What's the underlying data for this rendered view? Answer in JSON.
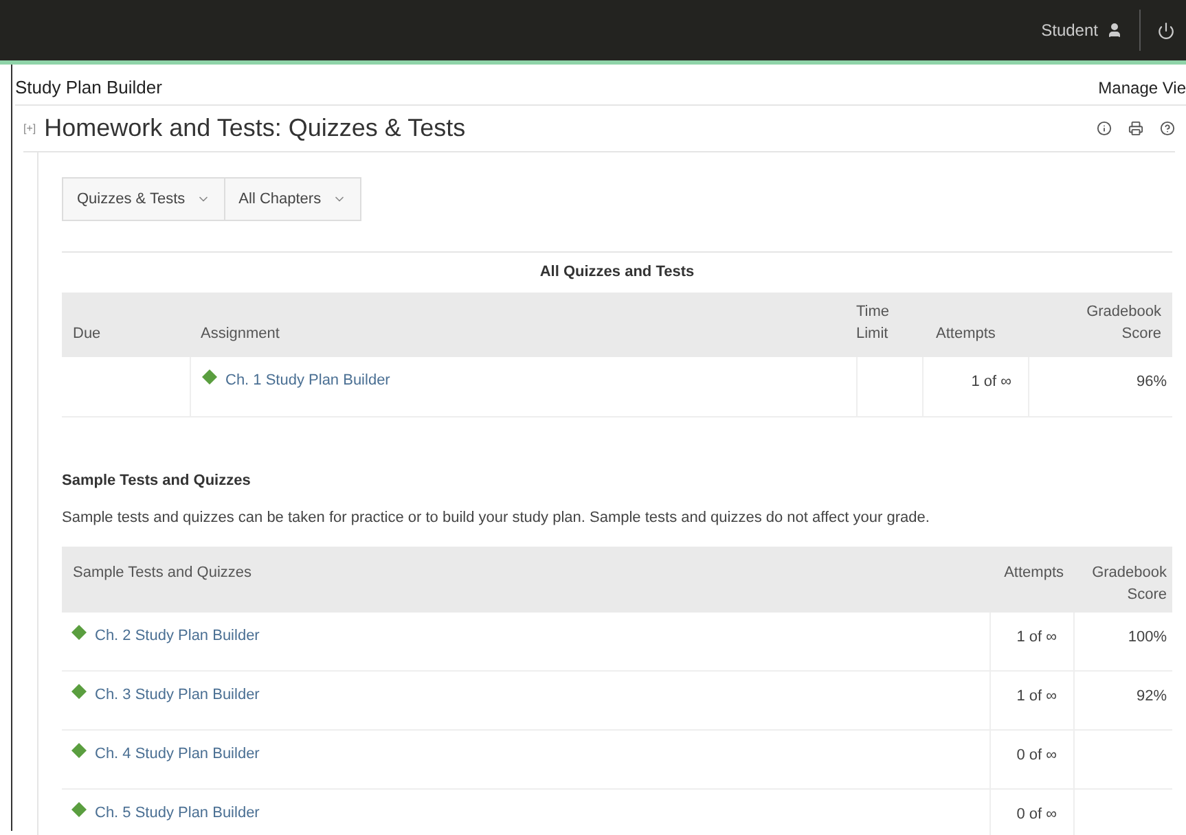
{
  "top_bar": {
    "user": "Student"
  },
  "page": {
    "title": "Study Plan Builder",
    "manage": "Manage Vie"
  },
  "panel": {
    "toggle": "[+]",
    "title": "Homework and Tests: Quizzes & Tests"
  },
  "filters": [
    "Quizzes & Tests",
    "All Chapters"
  ],
  "all_table": {
    "caption": "All Quizzes and Tests",
    "columns": [
      "Due",
      "Assignment",
      "Time Limit",
      "Attempts",
      "Gradebook Score"
    ],
    "rows": [
      {
        "assignment": "Ch. 1 Study Plan Builder",
        "attempts": "1 of ∞",
        "score": "96%",
        "color": "#5a9e3f"
      }
    ]
  },
  "sample": {
    "heading": "Sample Tests and Quizzes",
    "description": "Sample tests and quizzes can be taken for practice or to build your study plan. Sample tests and quizzes do not affect your grade.",
    "columns": [
      "Sample Tests and Quizzes",
      "Attempts",
      "Gradebook Score"
    ],
    "rows": [
      {
        "assignment": "Ch. 2 Study Plan Builder",
        "attempts": "1 of ∞",
        "score": "100%",
        "color": "#5a9e3f"
      },
      {
        "assignment": "Ch. 3 Study Plan Builder",
        "attempts": "1 of ∞",
        "score": "92%",
        "color": "#5a9e3f"
      },
      {
        "assignment": "Ch. 4 Study Plan Builder",
        "attempts": "0 of ∞",
        "color": "#5a9e3f"
      },
      {
        "assignment": "Ch. 5 Study Plan Builder",
        "attempts": "0 of ∞",
        "color": "#5a9e3f"
      }
    ]
  }
}
